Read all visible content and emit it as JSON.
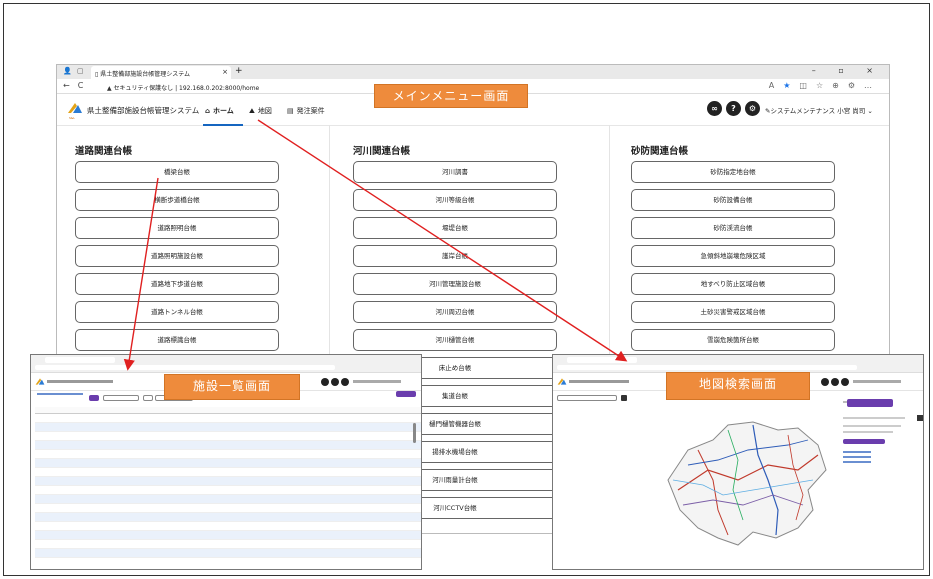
{
  "browser": {
    "tab_title": "県土整備部施設台帳管理システム",
    "security_warning": "セキュリティ保護なし",
    "url": "192.168.0.202:8000/home"
  },
  "app": {
    "title": "県土整備部施設台帳管理システム",
    "logo_caption": "S&L",
    "nav": [
      {
        "label": "ホーム",
        "icon": "home-icon"
      },
      {
        "label": "地図",
        "icon": "map-icon"
      },
      {
        "label": "発注案件",
        "icon": "order-icon"
      }
    ],
    "help_label": "?",
    "user_menu": "システムメンテナンス 小宮 尚司"
  },
  "columns": [
    {
      "title": "道路関連台帳",
      "items": [
        "橋梁台帳",
        "横断歩道橋台帳",
        "道路照明台帳",
        "道路照明施設台帳",
        "道路地下歩道台帳",
        "道路トンネル台帳",
        "道路標識台帳"
      ]
    },
    {
      "title": "河川関連台帳",
      "items": [
        "河川調書",
        "河川等級台帳",
        "堰堤台帳",
        "護岸台帳",
        "河川管理施設台帳",
        "河川周辺台帳",
        "河川樋管台帳",
        "床止め台帳",
        "集道台帳",
        "樋門樋管機器台帳",
        "揚排水機場台帳",
        "河川雨量計台帳",
        "河川CCTV台帳"
      ]
    },
    {
      "title": "砂防関連台帳",
      "items": [
        "砂防指定地台帳",
        "砂防設備台帳",
        "砂防渓流台帳",
        "急傾斜地崩壊危険区域",
        "地すべり防止区域台帳",
        "土砂災害警戒区域台帳",
        "雪崩危険箇所台帳"
      ]
    }
  ],
  "callouts": {
    "main": "メインメニュー画面",
    "list": "施設一覧画面",
    "map": "地図検索画面"
  },
  "accent_colors": {
    "callout": "#ee8b3c",
    "arrow": "#e02020",
    "active_nav": "#1565c0"
  }
}
